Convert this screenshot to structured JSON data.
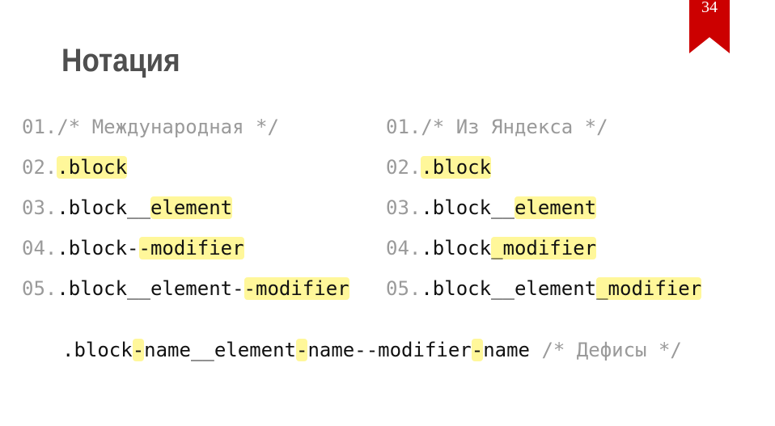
{
  "slide": {
    "title": "Нотация",
    "page_number": "34"
  },
  "colors": {
    "badge": "#cc0000",
    "highlight": "#fff79a",
    "title": "#4f4f4f",
    "muted": "#9a9a9a",
    "code": "#111111"
  },
  "left_column": {
    "lines": [
      {
        "num": "01.",
        "comment": "/* Международная */"
      },
      {
        "num": "02.",
        "highlight": ".block"
      },
      {
        "num": "03.",
        "plain": ".block__",
        "highlight": "element"
      },
      {
        "num": "04.",
        "plain": ".block-",
        "highlight": "-modifier"
      },
      {
        "num": "05.",
        "plain": ".block__element-",
        "highlight": "-modifier"
      }
    ]
  },
  "right_column": {
    "lines": [
      {
        "num": "01.",
        "comment": "/* Из Яндекса */"
      },
      {
        "num": "02.",
        "highlight": ".block"
      },
      {
        "num": "03.",
        "plain": ".block__",
        "highlight": "element"
      },
      {
        "num": "04.",
        "plain": ".block",
        "highlight": "_modifier"
      },
      {
        "num": "05.",
        "plain": ".block__element",
        "highlight": "_modifier"
      }
    ]
  },
  "example": {
    "part1": ".block",
    "hyphen1": "-",
    "part2": "name__element",
    "hyphen2": "-",
    "part3": "name--modifier",
    "hyphen3": "-",
    "part4": "name",
    "comment": " /* Дефисы */"
  }
}
